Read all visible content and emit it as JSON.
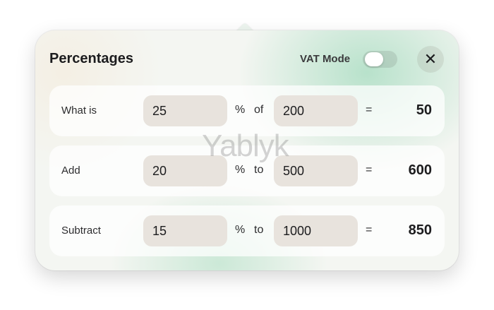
{
  "header": {
    "title": "Percentages",
    "vat_mode_label": "VAT Mode",
    "vat_mode_on": false,
    "close_glyph": "✕"
  },
  "rows": [
    {
      "label": "What is",
      "value_a": "25",
      "percent_sign": "%",
      "connector": "of",
      "value_b": "200",
      "equals": "=",
      "result": "50"
    },
    {
      "label": "Add",
      "value_a": "20",
      "percent_sign": "%",
      "connector": "to",
      "value_b": "500",
      "equals": "=",
      "result": "600"
    },
    {
      "label": "Subtract",
      "value_a": "15",
      "percent_sign": "%",
      "connector": "to",
      "value_b": "1000",
      "equals": "=",
      "result": "850"
    }
  ],
  "watermark": "Yablyk",
  "icons": {
    "close": "close-icon"
  }
}
